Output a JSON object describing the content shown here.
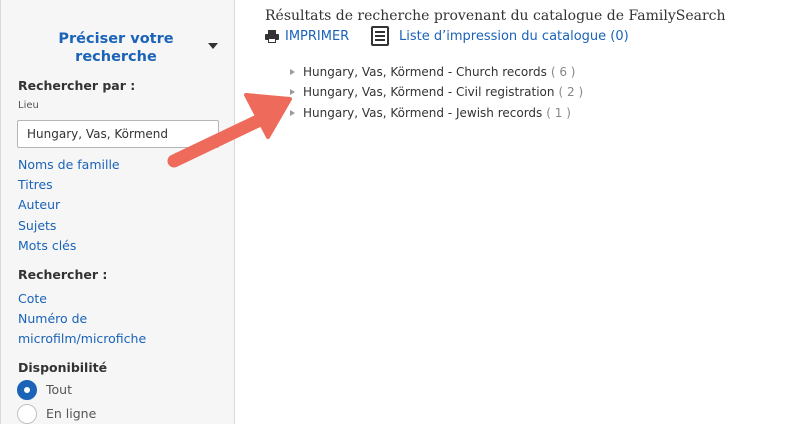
{
  "sidebar": {
    "title": "Préciser votre recherche",
    "search_by_label": "Rechercher par :",
    "place_label": "Lieu",
    "place_value": "Hungary, Vas, Körmend",
    "search_by_links": [
      "Noms de famille",
      "Titres",
      "Auteur",
      "Sujets",
      "Mots clés"
    ],
    "search_label": "Rechercher :",
    "search_links": [
      "Cote",
      "Numéro de",
      "microfilm/microfiche"
    ],
    "availability_label": "Disponibilité",
    "availability_options": [
      {
        "label": "Tout",
        "selected": true
      },
      {
        "label": "En ligne",
        "selected": false
      }
    ]
  },
  "main": {
    "title": "Résultats de recherche provenant du catalogue de FamilySearch",
    "print_label": "IMPRIMER",
    "print_list_label": "Liste d’impression du catalogue (0)",
    "results": [
      {
        "label": "Hungary, Vas, Körmend - Church records",
        "count": "( 6 )"
      },
      {
        "label": "Hungary, Vas, Körmend - Civil registration",
        "count": "( 2 )"
      },
      {
        "label": "Hungary, Vas, Körmend - Jewish records",
        "count": "( 1 )"
      }
    ]
  },
  "icons": {
    "caret": "chevron-down-icon",
    "print": "printer-icon",
    "list": "document-list-icon",
    "expand": "triangle-right-icon",
    "annotation": "arrow-annotation"
  },
  "colors": {
    "link": "#1a63b8",
    "arrow": "#ee6a5a",
    "sidebar_bg": "#f6f6f6"
  }
}
